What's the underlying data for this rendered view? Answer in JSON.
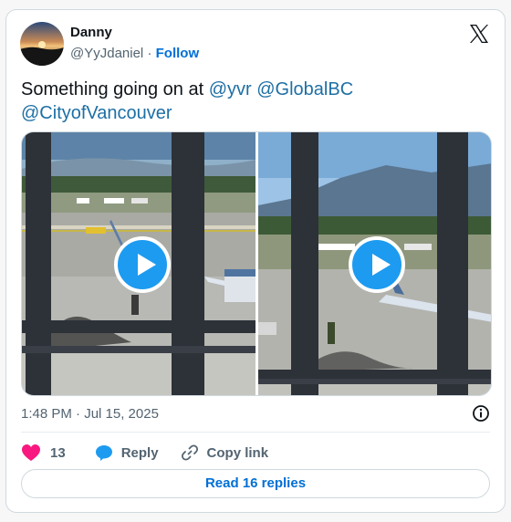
{
  "author": {
    "name": "Danny",
    "handle": "@YyJdaniel",
    "separator": "·",
    "follow_label": "Follow"
  },
  "tweet": {
    "text_prefix": "Something going on at ",
    "mentions": [
      "@yvr",
      "@GlobalBC",
      "@CityofVancouver"
    ],
    "timestamp": "1:48 PM · Jul 15, 2025"
  },
  "media": {
    "count": 2,
    "items": [
      {
        "type": "video",
        "icon": "play-icon"
      },
      {
        "type": "video",
        "icon": "play-icon"
      }
    ]
  },
  "actions": {
    "likes_count": "13",
    "reply_label": "Reply",
    "copy_link_label": "Copy link",
    "read_replies_label": "Read 16 replies"
  },
  "colors": {
    "link": "#006fd6",
    "mention": "#1d6fa5",
    "like": "#f91880",
    "play_button": "#1d9bf0",
    "secondary_text": "#536471",
    "border": "#cfd9de"
  },
  "icons": [
    "avatar",
    "x-logo-icon",
    "play-icon",
    "info-icon",
    "heart-icon",
    "reply-bubble-icon",
    "link-icon"
  ]
}
